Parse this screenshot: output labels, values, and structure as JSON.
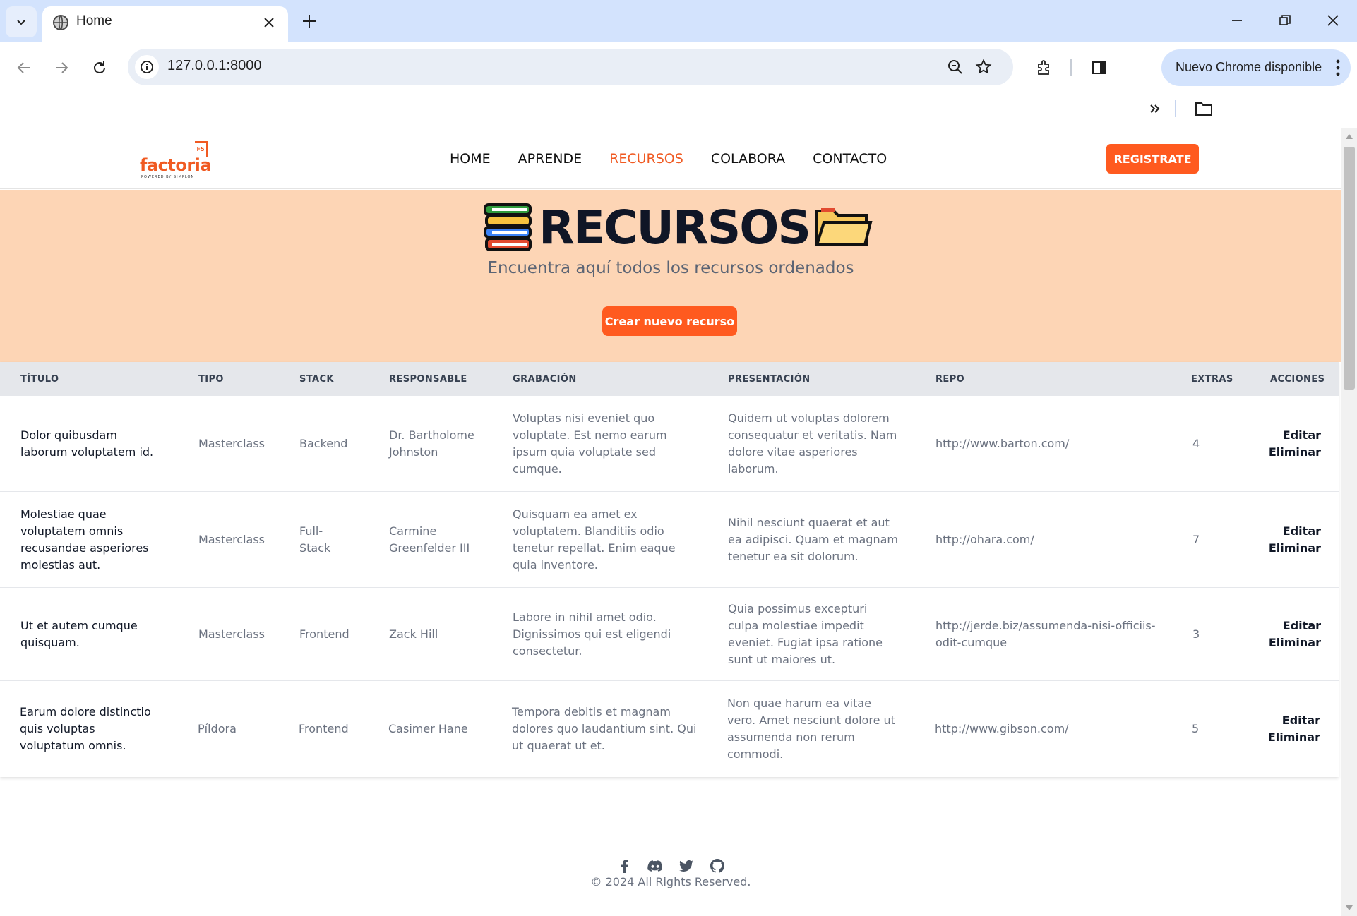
{
  "browser": {
    "tab_title": "Home",
    "url": "127.0.0.1:8000",
    "update_label": "Nuevo Chrome disponible"
  },
  "site": {
    "logo_text": "factoria",
    "logo_tagline": "POWERED BY SIMPLON",
    "logo_badge": "F5",
    "nav": [
      "HOME",
      "APRENDE",
      "RECURSOS",
      "COLABORA",
      "CONTACTO"
    ],
    "active_nav": "RECURSOS",
    "register_label": "REGISTRATE"
  },
  "hero": {
    "title": "RECURSOS",
    "subtitle": "Encuentra aquí todos los recursos ordenados",
    "create_label": "Crear nuevo recurso"
  },
  "table": {
    "headers": [
      "TÍTULO",
      "TIPO",
      "STACK",
      "RESPONSABLE",
      "GRABACIÓN",
      "PRESENTACIÓN",
      "REPO",
      "EXTRAS",
      "ACCIONES"
    ],
    "rows": [
      {
        "titulo": "Dolor quibusdam laborum voluptatem id.",
        "tipo": "Masterclass",
        "stack": "Backend",
        "responsable": "Dr. Bartholome Johnston",
        "grabacion": "Voluptas nisi eveniet quo voluptate. Est nemo earum ipsum quia voluptate sed cumque.",
        "presentacion": "Quidem ut voluptas dolorem consequatur et veritatis. Nam dolore vitae asperiores laborum.",
        "repo": "http://www.barton.com/",
        "extras": "4",
        "edit": "Editar",
        "delete": "Eliminar"
      },
      {
        "titulo": "Molestiae quae voluptatem omnis recusandae asperiores molestias aut.",
        "tipo": "Masterclass",
        "stack": "Full-Stack",
        "responsable": "Carmine Greenfelder III",
        "grabacion": "Quisquam ea amet ex voluptatem. Blanditiis odio tenetur repellat. Enim eaque quia inventore.",
        "presentacion": "Nihil nesciunt quaerat et aut ea adipisci. Quam et magnam tenetur ea sit dolorum.",
        "repo": "http://ohara.com/",
        "extras": "7",
        "edit": "Editar",
        "delete": "Eliminar"
      },
      {
        "titulo": "Ut et autem cumque quisquam.",
        "tipo": "Masterclass",
        "stack": "Frontend",
        "responsable": "Zack Hill",
        "grabacion": "Labore in nihil amet odio. Dignissimos qui est eligendi consectetur.",
        "presentacion": "Quia possimus excepturi culpa molestiae impedit eveniet. Fugiat ipsa ratione sunt ut maiores ut.",
        "repo": "http://jerde.biz/assumenda-nisi-officiis-odit-cumque",
        "extras": "3",
        "edit": "Editar",
        "delete": "Eliminar"
      },
      {
        "titulo": "Earum dolore distinctio quis voluptas voluptatum omnis.",
        "tipo": "Píldora",
        "stack": "Frontend",
        "responsable": "Casimer Hane",
        "grabacion": "Tempora debitis et magnam dolores quo laudantium sint. Qui ut quaerat ut et.",
        "presentacion": "Non quae harum ea vitae vero. Amet nesciunt dolore ut assumenda non rerum commodi.",
        "repo": "http://www.gibson.com/",
        "extras": "5",
        "edit": "Editar",
        "delete": "Eliminar"
      }
    ]
  },
  "footer": {
    "social": [
      "facebook-icon",
      "discord-icon",
      "twitter-icon",
      "github-icon"
    ],
    "copyright": "© 2024 All Rights Reserved."
  },
  "colors": {
    "accent": "#ff5a1f",
    "hero_bg": "#fdd5b5",
    "chrome_tabstrip": "#d3e3fd"
  }
}
